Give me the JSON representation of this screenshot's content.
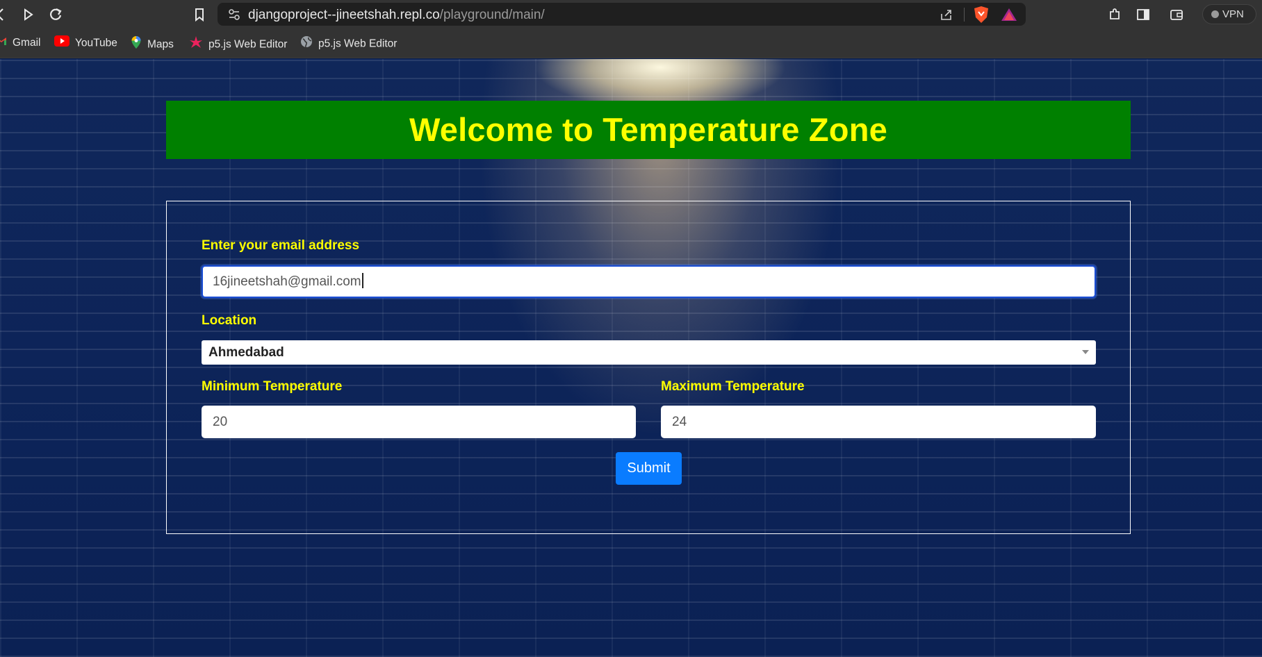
{
  "browser": {
    "url_host": "djangoproject--jineetshah.repl.co",
    "url_path": "/playground/main/",
    "vpn_label": "VPN",
    "bookmarks": [
      {
        "label": "Gmail",
        "icon": "gmail-icon"
      },
      {
        "label": "YouTube",
        "icon": "youtube-icon"
      },
      {
        "label": "Maps",
        "icon": "maps-icon"
      },
      {
        "label": "p5.js Web Editor",
        "icon": "p5js-star-icon"
      },
      {
        "label": "p5.js Web Editor",
        "icon": "globe-icon"
      }
    ]
  },
  "page": {
    "title": "Welcome to Temperature Zone",
    "email_label": "Enter your email address",
    "email_value": "16jineetshah@gmail.com",
    "location_label": "Location",
    "location_value": "Ahmedabad",
    "min_label": "Minimum Temperature",
    "min_value": "20",
    "max_label": "Maximum Temperature",
    "max_value": "24",
    "submit_label": "Submit"
  },
  "colors": {
    "banner_bg": "#008000",
    "accent_text": "#ffff00",
    "submit_bg": "#0a7cff",
    "chrome_bg": "#333333"
  }
}
